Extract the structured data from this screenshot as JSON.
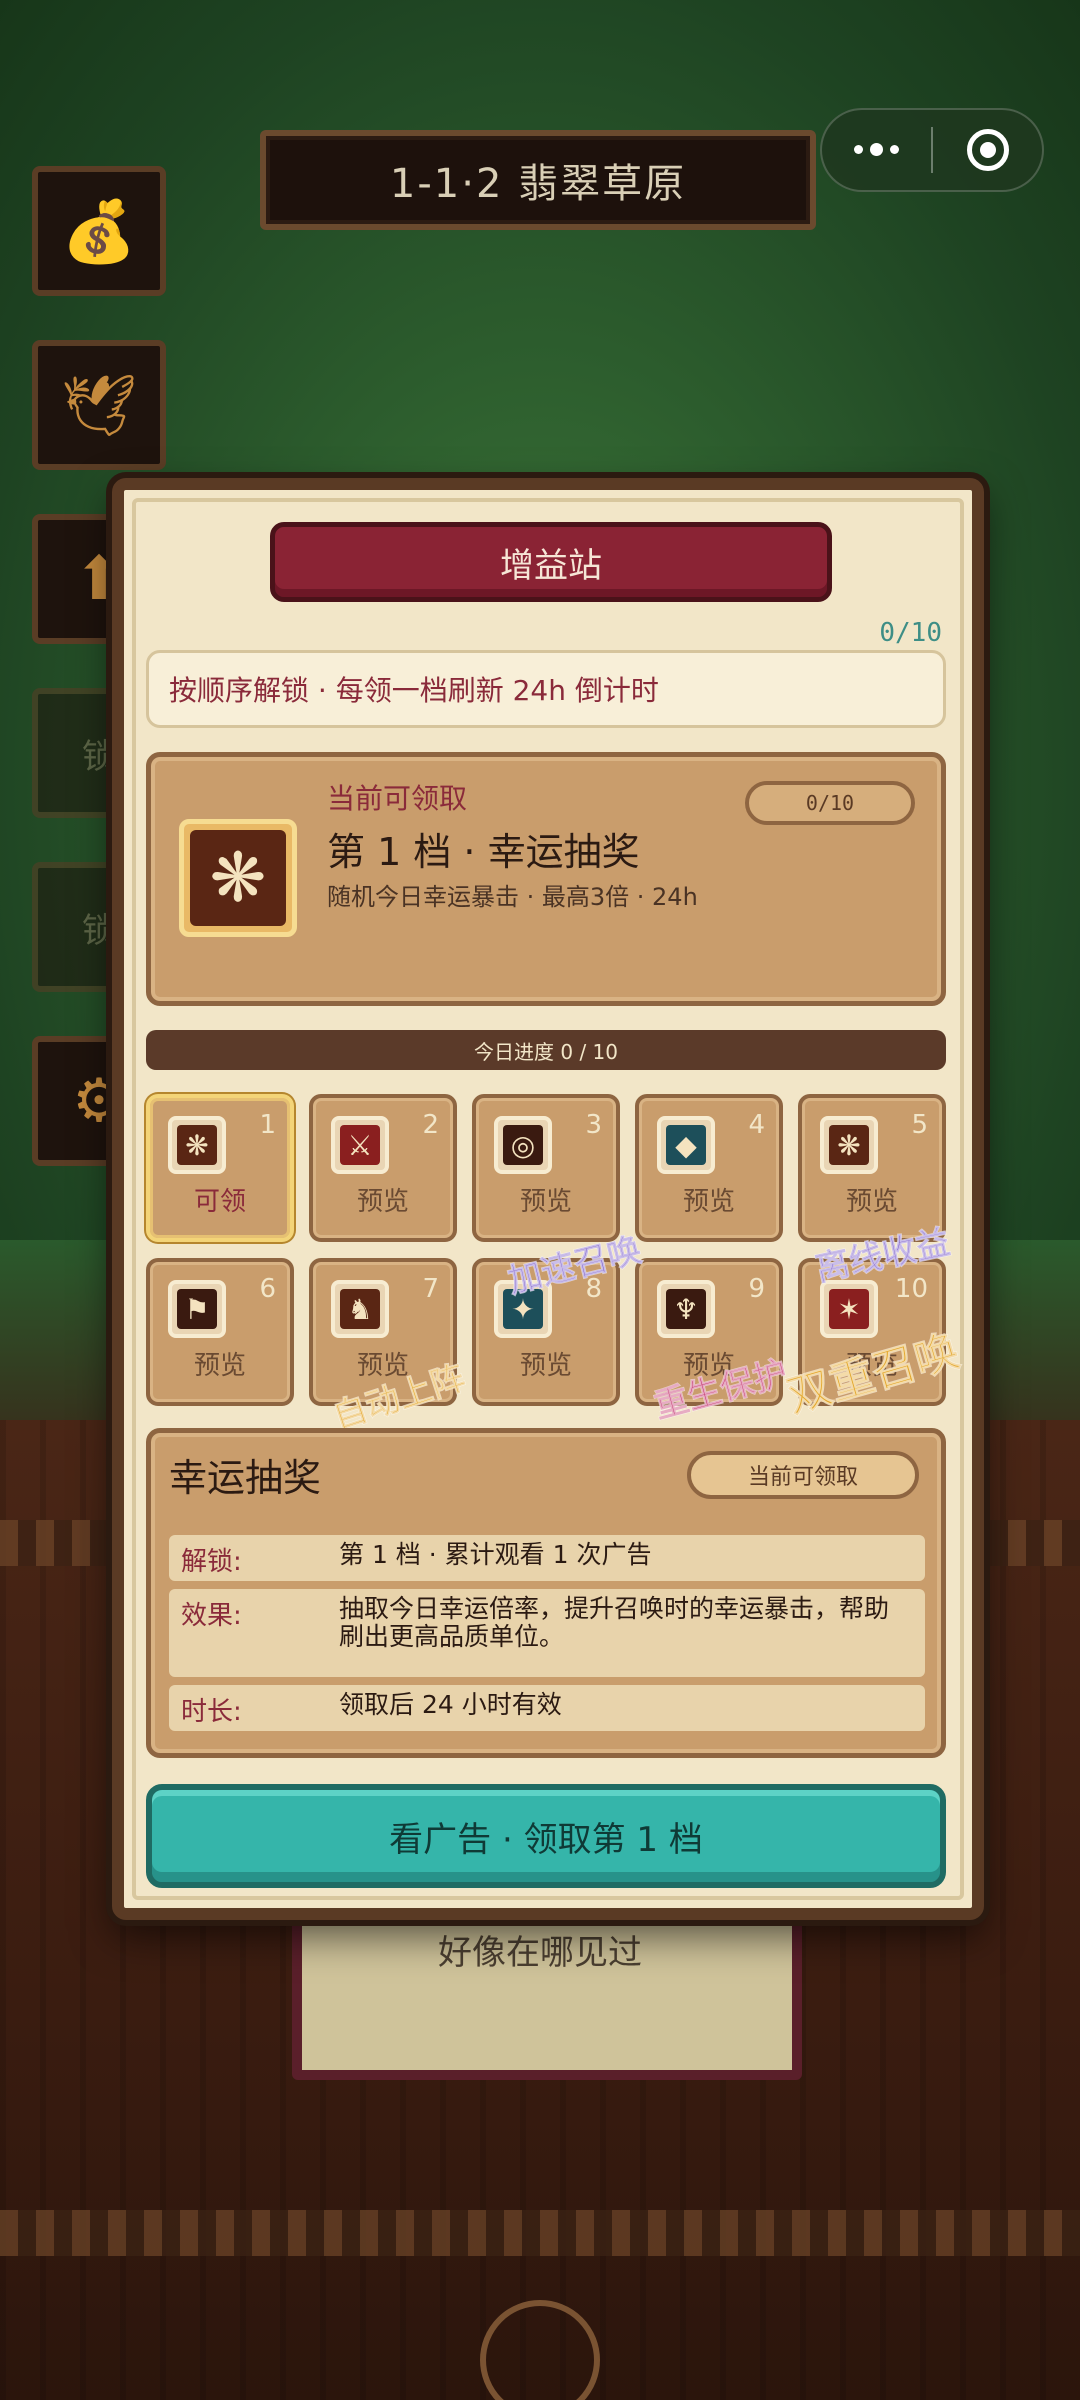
{
  "stage": {
    "title": "1-1·2 翡翠草原"
  },
  "background": {
    "book_text": "好像在哪见过"
  },
  "side_buttons": [
    {
      "icon": "money-bag-icon",
      "glyph": "💰"
    },
    {
      "icon": "wing-upgrade-icon",
      "glyph": "🕊"
    },
    {
      "icon": "upgrade-arrow-icon",
      "glyph": "⬆"
    },
    {
      "icon": "locked-slot-icon",
      "label": "锁"
    },
    {
      "icon": "locked-shield-icon",
      "label": "锁"
    },
    {
      "icon": "gear-icon",
      "glyph": "⚙"
    }
  ],
  "modal": {
    "title": "增益站",
    "count": "0/10",
    "rule": "按顺序解锁 · 每领一档刷新 24h 倒计时",
    "current": {
      "label": "当前可领取",
      "title": "第 1 档 · 幸运抽奖",
      "desc": "随机今日幸运暴击 · 最高3倍 · 24h",
      "pill": "0/10",
      "icon": "snowflake-burst-icon"
    },
    "progress": {
      "text": "今日进度 0 / 10",
      "value": 0,
      "max": 10
    },
    "tiers": [
      {
        "num": "1",
        "status": "可领",
        "icon": "snowflake-burst-icon",
        "glyph": "❋",
        "color": "#5a2614"
      },
      {
        "num": "2",
        "status": "预览",
        "icon": "crossed-swords-icon",
        "glyph": "⚔",
        "color": "#8a1f1f"
      },
      {
        "num": "3",
        "status": "预览",
        "icon": "fire-ring-icon",
        "glyph": "◎",
        "color": "#3a1a10"
      },
      {
        "num": "4",
        "status": "预览",
        "icon": "crystal-blade-icon",
        "glyph": "◆",
        "color": "#1d4f5a"
      },
      {
        "num": "5",
        "status": "预览",
        "icon": "snowflake-burst-icon",
        "glyph": "❋",
        "color": "#5a2614"
      },
      {
        "num": "6",
        "status": "预览",
        "icon": "red-banner-icon",
        "glyph": "⚑",
        "color": "#3a1a10"
      },
      {
        "num": "7",
        "status": "预览",
        "icon": "warrior-icon",
        "glyph": "♞",
        "color": "#5a2614"
      },
      {
        "num": "8",
        "status": "预览",
        "icon": "spirit-icon",
        "glyph": "✦",
        "color": "#1d4f5a"
      },
      {
        "num": "9",
        "status": "预览",
        "icon": "phoenix-icon",
        "glyph": "♆",
        "color": "#3a1a10"
      },
      {
        "num": "10",
        "status": "预览",
        "icon": "twin-blades-icon",
        "glyph": "✶",
        "color": "#8a1f1f"
      }
    ],
    "floaters": {
      "f1": {
        "text": "加速召唤",
        "color": "#7b5cc9"
      },
      "f2": {
        "text": "离线收益",
        "color": "#7b5cc9"
      },
      "f3": {
        "text": "自动上阵",
        "color": "#e3a629"
      },
      "f4": {
        "text": "重生保护",
        "color": "#c2306a"
      },
      "f5": {
        "text": "双重召唤",
        "color": "#e3a629"
      }
    },
    "detail": {
      "name": "幸运抽奖",
      "pill": "当前可领取",
      "unlock_key": "解锁:",
      "unlock_val": "第 1 档 · 累计观看 1 次广告",
      "effect_key": "效果:",
      "effect_val": "抽取今日幸运倍率，提升召唤时的幸运暴击，帮助刷出更高品质单位。",
      "duration_key": "时长:",
      "duration_val": "领取后 24 小时有效"
    },
    "cta": "看广告 · 领取第 1 档"
  }
}
